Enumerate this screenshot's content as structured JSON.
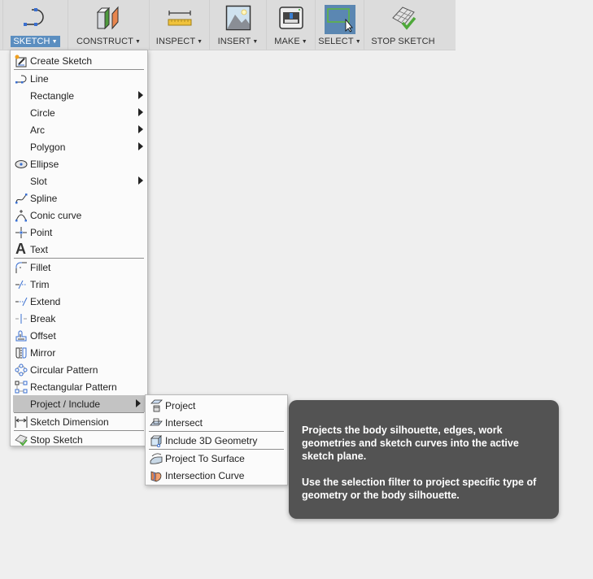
{
  "toolbar": {
    "groups": [
      {
        "id": "sketch",
        "label": "SKETCH",
        "has_dropdown": true,
        "active": true
      },
      {
        "id": "construct",
        "label": "CONSTRUCT",
        "has_dropdown": true
      },
      {
        "id": "inspect",
        "label": "INSPECT",
        "has_dropdown": true
      },
      {
        "id": "insert",
        "label": "INSERT",
        "has_dropdown": true
      },
      {
        "id": "make",
        "label": "MAKE",
        "has_dropdown": true
      },
      {
        "id": "select",
        "label": "SELECT",
        "has_dropdown": true
      },
      {
        "id": "stop-sketch",
        "label": "STOP SKETCH",
        "has_dropdown": false
      }
    ],
    "caret": "▼"
  },
  "sketch_menu": {
    "items": [
      {
        "label": "Create Sketch",
        "icon": "create-sketch-icon"
      },
      {
        "label": "Line",
        "icon": "line-icon"
      },
      {
        "label": "Rectangle",
        "submenu": true
      },
      {
        "label": "Circle",
        "submenu": true
      },
      {
        "label": "Arc",
        "submenu": true
      },
      {
        "label": "Polygon",
        "submenu": true
      },
      {
        "label": "Ellipse",
        "icon": "ellipse-icon"
      },
      {
        "label": "Slot",
        "submenu": true
      },
      {
        "label": "Spline",
        "icon": "spline-icon"
      },
      {
        "label": "Conic curve",
        "icon": "conic-curve-icon"
      },
      {
        "label": "Point",
        "icon": "point-icon"
      },
      {
        "label": "Text",
        "icon": "text-icon"
      },
      {
        "label": "Fillet",
        "icon": "fillet-icon"
      },
      {
        "label": "Trim",
        "icon": "trim-icon"
      },
      {
        "label": "Extend",
        "icon": "extend-icon"
      },
      {
        "label": "Break",
        "icon": "break-icon"
      },
      {
        "label": "Offset",
        "icon": "offset-icon"
      },
      {
        "label": "Mirror",
        "icon": "mirror-icon"
      },
      {
        "label": "Circular Pattern",
        "icon": "circular-pattern-icon"
      },
      {
        "label": "Rectangular Pattern",
        "icon": "rectangular-pattern-icon"
      },
      {
        "label": "Project / Include",
        "submenu": true,
        "active": true
      },
      {
        "label": "Sketch Dimension",
        "icon": "sketch-dimension-icon"
      },
      {
        "label": "Stop Sketch",
        "icon": "stop-sketch-icon"
      }
    ]
  },
  "project_submenu": {
    "items": [
      {
        "label": "Project",
        "icon": "project-icon"
      },
      {
        "label": "Intersect",
        "icon": "intersect-icon"
      },
      {
        "label": "Include 3D Geometry",
        "icon": "include-3d-geometry-icon"
      },
      {
        "label": "Project To Surface",
        "icon": "project-to-surface-icon"
      },
      {
        "label": "Intersection Curve",
        "icon": "intersection-curve-icon"
      }
    ]
  },
  "tooltip": {
    "paragraph1": "Projects the body silhouette, edges, work geometries and sketch curves into the active sketch plane.",
    "paragraph2": "Use the selection filter to project specific type of geometry or the body silhouette."
  }
}
